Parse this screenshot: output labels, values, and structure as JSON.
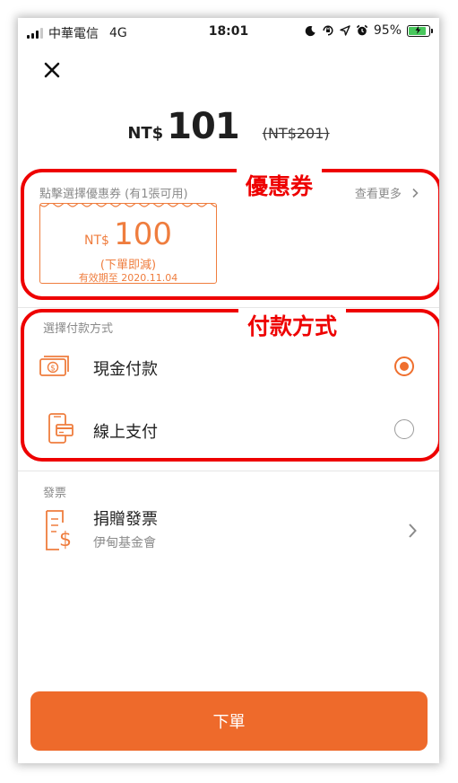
{
  "status_bar": {
    "carrier": "中華電信",
    "network": "4G",
    "time": "18:01",
    "battery": "95%"
  },
  "price": {
    "currency": "NT$",
    "amount": "101",
    "original": "(NT$201)"
  },
  "coupon": {
    "hint": "點擊選擇優惠券 (有1張可用)",
    "see_more": "查看更多",
    "ticket_currency": "NT$",
    "ticket_amount": "100",
    "ticket_note": "(下單即減)",
    "ticket_expiry": "有效期至 2020.11.04"
  },
  "payment": {
    "section_title": "選擇付款方式",
    "options": [
      {
        "label": "現金付款",
        "selected": true,
        "icon": "cash-icon"
      },
      {
        "label": "線上支付",
        "selected": false,
        "icon": "mobile-payment-icon"
      }
    ]
  },
  "invoice": {
    "section_title": "發票",
    "title": "捐贈發票",
    "subtitle": "伊甸基金會",
    "icon": "invoice-icon"
  },
  "order_button": "下單",
  "annotations": {
    "coupon": "優惠券",
    "payment": "付款方式"
  },
  "colors": {
    "accent": "#ee6a2b",
    "annotation": "#ee0000"
  }
}
